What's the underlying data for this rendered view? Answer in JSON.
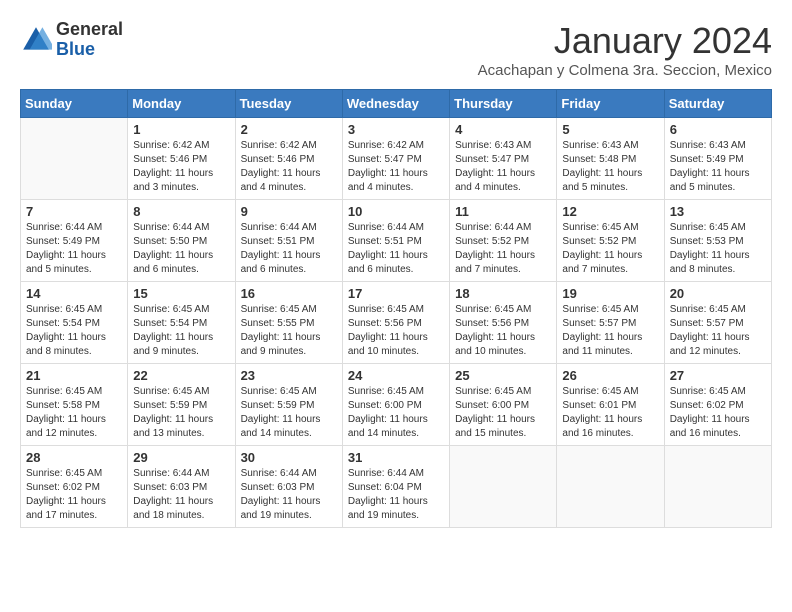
{
  "header": {
    "logo_general": "General",
    "logo_blue": "Blue",
    "month_title": "January 2024",
    "subtitle": "Acachapan y Colmena 3ra. Seccion, Mexico"
  },
  "days_of_week": [
    "Sunday",
    "Monday",
    "Tuesday",
    "Wednesday",
    "Thursday",
    "Friday",
    "Saturday"
  ],
  "weeks": [
    [
      {
        "day": "",
        "info": ""
      },
      {
        "day": "1",
        "info": "Sunrise: 6:42 AM\nSunset: 5:46 PM\nDaylight: 11 hours\nand 3 minutes."
      },
      {
        "day": "2",
        "info": "Sunrise: 6:42 AM\nSunset: 5:46 PM\nDaylight: 11 hours\nand 4 minutes."
      },
      {
        "day": "3",
        "info": "Sunrise: 6:42 AM\nSunset: 5:47 PM\nDaylight: 11 hours\nand 4 minutes."
      },
      {
        "day": "4",
        "info": "Sunrise: 6:43 AM\nSunset: 5:47 PM\nDaylight: 11 hours\nand 4 minutes."
      },
      {
        "day": "5",
        "info": "Sunrise: 6:43 AM\nSunset: 5:48 PM\nDaylight: 11 hours\nand 5 minutes."
      },
      {
        "day": "6",
        "info": "Sunrise: 6:43 AM\nSunset: 5:49 PM\nDaylight: 11 hours\nand 5 minutes."
      }
    ],
    [
      {
        "day": "7",
        "info": "Sunrise: 6:44 AM\nSunset: 5:49 PM\nDaylight: 11 hours\nand 5 minutes."
      },
      {
        "day": "8",
        "info": "Sunrise: 6:44 AM\nSunset: 5:50 PM\nDaylight: 11 hours\nand 6 minutes."
      },
      {
        "day": "9",
        "info": "Sunrise: 6:44 AM\nSunset: 5:51 PM\nDaylight: 11 hours\nand 6 minutes."
      },
      {
        "day": "10",
        "info": "Sunrise: 6:44 AM\nSunset: 5:51 PM\nDaylight: 11 hours\nand 6 minutes."
      },
      {
        "day": "11",
        "info": "Sunrise: 6:44 AM\nSunset: 5:52 PM\nDaylight: 11 hours\nand 7 minutes."
      },
      {
        "day": "12",
        "info": "Sunrise: 6:45 AM\nSunset: 5:52 PM\nDaylight: 11 hours\nand 7 minutes."
      },
      {
        "day": "13",
        "info": "Sunrise: 6:45 AM\nSunset: 5:53 PM\nDaylight: 11 hours\nand 8 minutes."
      }
    ],
    [
      {
        "day": "14",
        "info": "Sunrise: 6:45 AM\nSunset: 5:54 PM\nDaylight: 11 hours\nand 8 minutes."
      },
      {
        "day": "15",
        "info": "Sunrise: 6:45 AM\nSunset: 5:54 PM\nDaylight: 11 hours\nand 9 minutes."
      },
      {
        "day": "16",
        "info": "Sunrise: 6:45 AM\nSunset: 5:55 PM\nDaylight: 11 hours\nand 9 minutes."
      },
      {
        "day": "17",
        "info": "Sunrise: 6:45 AM\nSunset: 5:56 PM\nDaylight: 11 hours\nand 10 minutes."
      },
      {
        "day": "18",
        "info": "Sunrise: 6:45 AM\nSunset: 5:56 PM\nDaylight: 11 hours\nand 10 minutes."
      },
      {
        "day": "19",
        "info": "Sunrise: 6:45 AM\nSunset: 5:57 PM\nDaylight: 11 hours\nand 11 minutes."
      },
      {
        "day": "20",
        "info": "Sunrise: 6:45 AM\nSunset: 5:57 PM\nDaylight: 11 hours\nand 12 minutes."
      }
    ],
    [
      {
        "day": "21",
        "info": "Sunrise: 6:45 AM\nSunset: 5:58 PM\nDaylight: 11 hours\nand 12 minutes."
      },
      {
        "day": "22",
        "info": "Sunrise: 6:45 AM\nSunset: 5:59 PM\nDaylight: 11 hours\nand 13 minutes."
      },
      {
        "day": "23",
        "info": "Sunrise: 6:45 AM\nSunset: 5:59 PM\nDaylight: 11 hours\nand 14 minutes."
      },
      {
        "day": "24",
        "info": "Sunrise: 6:45 AM\nSunset: 6:00 PM\nDaylight: 11 hours\nand 14 minutes."
      },
      {
        "day": "25",
        "info": "Sunrise: 6:45 AM\nSunset: 6:00 PM\nDaylight: 11 hours\nand 15 minutes."
      },
      {
        "day": "26",
        "info": "Sunrise: 6:45 AM\nSunset: 6:01 PM\nDaylight: 11 hours\nand 16 minutes."
      },
      {
        "day": "27",
        "info": "Sunrise: 6:45 AM\nSunset: 6:02 PM\nDaylight: 11 hours\nand 16 minutes."
      }
    ],
    [
      {
        "day": "28",
        "info": "Sunrise: 6:45 AM\nSunset: 6:02 PM\nDaylight: 11 hours\nand 17 minutes."
      },
      {
        "day": "29",
        "info": "Sunrise: 6:44 AM\nSunset: 6:03 PM\nDaylight: 11 hours\nand 18 minutes."
      },
      {
        "day": "30",
        "info": "Sunrise: 6:44 AM\nSunset: 6:03 PM\nDaylight: 11 hours\nand 19 minutes."
      },
      {
        "day": "31",
        "info": "Sunrise: 6:44 AM\nSunset: 6:04 PM\nDaylight: 11 hours\nand 19 minutes."
      },
      {
        "day": "",
        "info": ""
      },
      {
        "day": "",
        "info": ""
      },
      {
        "day": "",
        "info": ""
      }
    ]
  ]
}
